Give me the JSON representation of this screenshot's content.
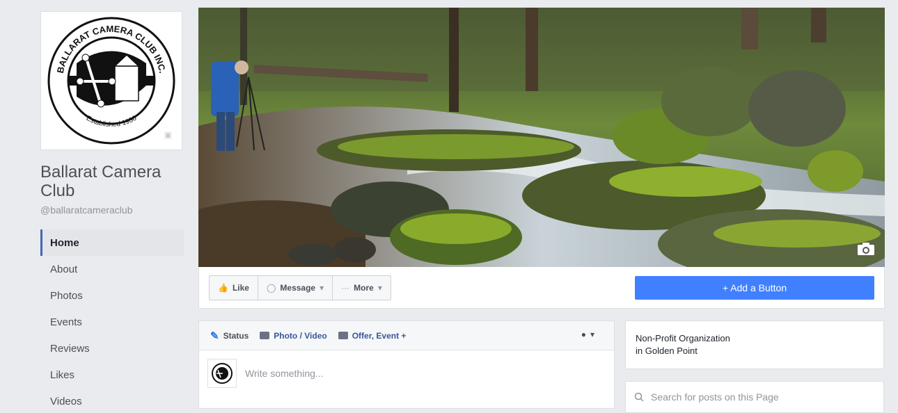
{
  "page": {
    "name": "Ballarat Camera Club",
    "handle": "@ballaratcameraclub"
  },
  "logo": {
    "top_text": "BALLARAT CAMERA CLUB INC.",
    "bottom_text": "Established 1936"
  },
  "nav": {
    "items": [
      {
        "label": "Home",
        "active": true
      },
      {
        "label": "About"
      },
      {
        "label": "Photos"
      },
      {
        "label": "Events"
      },
      {
        "label": "Reviews"
      },
      {
        "label": "Likes"
      },
      {
        "label": "Videos"
      }
    ]
  },
  "actions": {
    "like": "Like",
    "message": "Message",
    "more": "More",
    "add_button": "+ Add a Button"
  },
  "composer": {
    "status": "Status",
    "photo_video": "Photo / Video",
    "offer_event": "Offer, Event +",
    "placeholder": "Write something..."
  },
  "info": {
    "category": "Non-Profit Organization",
    "location": "in Golden Point"
  },
  "search": {
    "placeholder": "Search for posts on this Page"
  },
  "colors": {
    "accent": "#4080ff",
    "active_border": "#4267b2",
    "background": "#e9ebee"
  }
}
